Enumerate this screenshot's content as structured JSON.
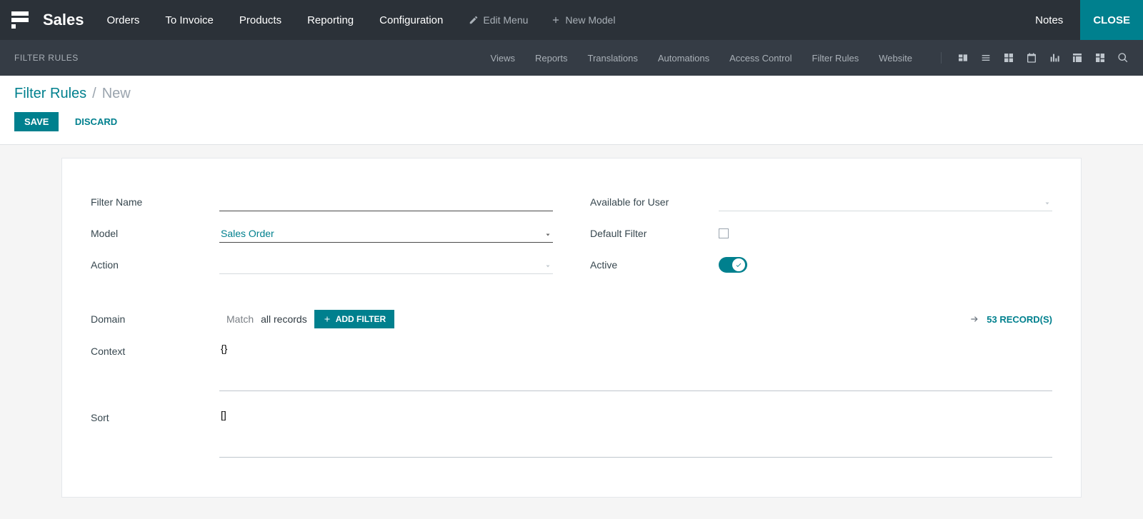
{
  "topnav": {
    "brand": "Sales",
    "items": [
      "Orders",
      "To Invoice",
      "Products",
      "Reporting",
      "Configuration"
    ],
    "edit_menu": "Edit Menu",
    "new_model": "New Model",
    "notes": "Notes",
    "close": "CLOSE"
  },
  "subnav": {
    "title": "Filter Rules",
    "tabs": [
      "Views",
      "Reports",
      "Translations",
      "Automations",
      "Access Control",
      "Filter Rules",
      "Website"
    ]
  },
  "breadcrumb": {
    "root": "Filter Rules",
    "sep": "/",
    "current": "New"
  },
  "buttons": {
    "save": "Save",
    "discard": "Discard",
    "add_filter": "Add Filter"
  },
  "labels": {
    "filter_name": "Filter Name",
    "model": "Model",
    "action": "Action",
    "available_user": "Available for User",
    "default_filter": "Default Filter",
    "active": "Active",
    "domain": "Domain",
    "context": "Context",
    "sort": "Sort"
  },
  "values": {
    "filter_name": "",
    "model": "Sales Order",
    "action": "",
    "available_user": "",
    "default_filter": false,
    "active": true,
    "context": "{}",
    "sort": "[]"
  },
  "domain": {
    "match_prefix": "Match ",
    "match_scope": "all records",
    "records_count": "53 Record(s)"
  }
}
